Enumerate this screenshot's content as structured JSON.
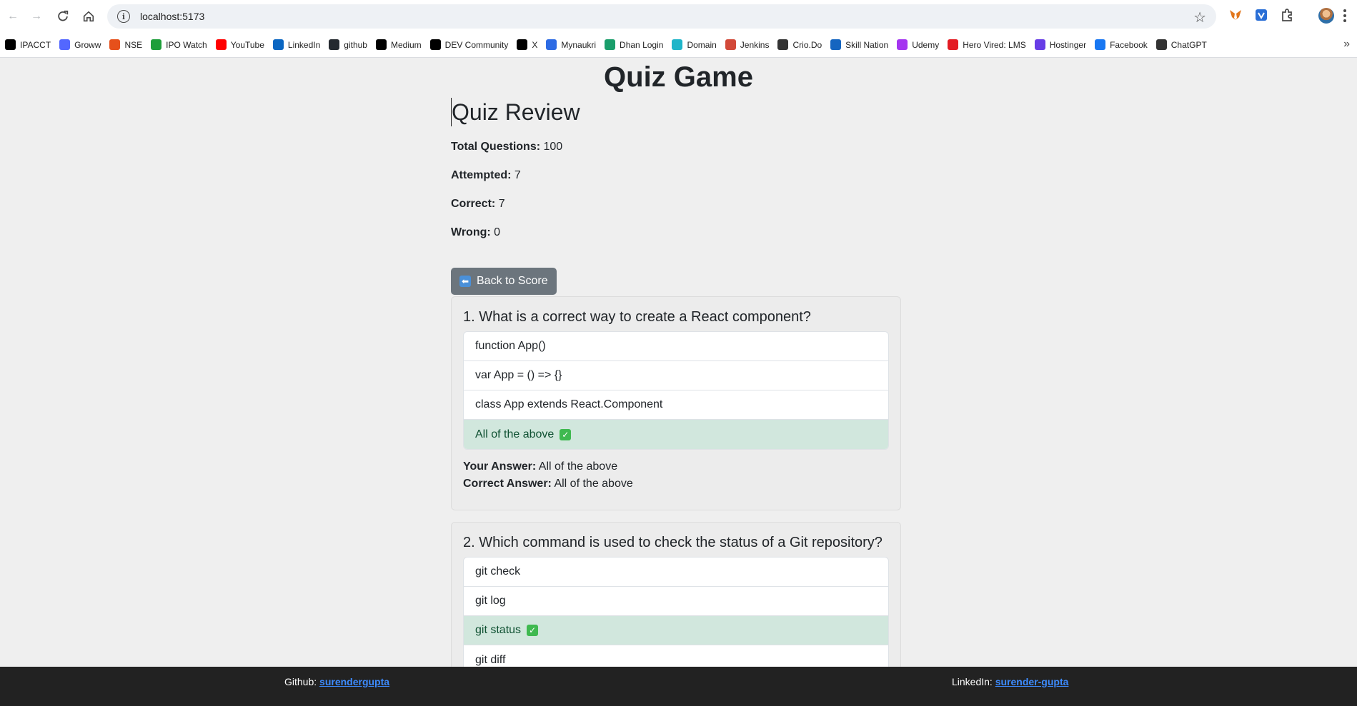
{
  "browser": {
    "url": "localhost:5173",
    "bookmarks": [
      {
        "label": "IPACCT",
        "icon": "ip-icon",
        "color": "#000000"
      },
      {
        "label": "Groww",
        "icon": "groww-icon",
        "color": "#5367ff"
      },
      {
        "label": "NSE",
        "icon": "nse-icon",
        "color": "#e6501b"
      },
      {
        "label": "IPO Watch",
        "icon": "ipo-icon",
        "color": "#1e9e3a"
      },
      {
        "label": "YouTube",
        "icon": "youtube-icon",
        "color": "#ff0000"
      },
      {
        "label": "LinkedIn",
        "icon": "linkedin-icon",
        "color": "#0a66c2"
      },
      {
        "label": "github",
        "icon": "github-icon",
        "color": "#24292f"
      },
      {
        "label": "Medium",
        "icon": "medium-icon",
        "color": "#000000"
      },
      {
        "label": "DEV Community",
        "icon": "dev-icon",
        "color": "#000000"
      },
      {
        "label": "X",
        "icon": "x-icon",
        "color": "#000000"
      },
      {
        "label": "Mynaukri",
        "icon": "mynaukri-icon",
        "color": "#2d6be4"
      },
      {
        "label": "Dhan Login",
        "icon": "dhan-icon",
        "color": "#1a9e6b"
      },
      {
        "label": "Domain",
        "icon": "domain-icon",
        "color": "#1fb5c9"
      },
      {
        "label": "Jenkins",
        "icon": "jenkins-icon",
        "color": "#d24939"
      },
      {
        "label": "Crio.Do",
        "icon": "crio-icon",
        "color": "#333333"
      },
      {
        "label": "Skill Nation",
        "icon": "skill-nation-icon",
        "color": "#1565c0"
      },
      {
        "label": "Udemy",
        "icon": "udemy-icon",
        "color": "#a435f0"
      },
      {
        "label": "Hero Vired: LMS",
        "icon": "hero-vired-icon",
        "color": "#e31b23"
      },
      {
        "label": "Hostinger",
        "icon": "hostinger-icon",
        "color": "#673de6"
      },
      {
        "label": "Facebook",
        "icon": "facebook-icon",
        "color": "#1877f2"
      },
      {
        "label": "ChatGPT",
        "icon": "chatgpt-icon",
        "color": "#333333"
      }
    ]
  },
  "app": {
    "title": "Quiz Game",
    "review_title": "Quiz Review",
    "stats": {
      "total_label": "Total Questions:",
      "total": "100",
      "attempted_label": "Attempted:",
      "attempted": "7",
      "correct_label": "Correct:",
      "correct": "7",
      "wrong_label": "Wrong:",
      "wrong": "0"
    },
    "back_label": "Back to Score",
    "your_answer_label": "Your Answer:",
    "correct_answer_label": "Correct Answer:",
    "questions": [
      {
        "text": "1. What is a correct way to create a React component?",
        "options": [
          "function App()",
          "var App = () => {}",
          "class App extends React.Component",
          "All of the above"
        ],
        "correct_index": 3,
        "your_answer": "All of the above",
        "correct_answer": "All of the above"
      },
      {
        "text": "2. Which command is used to check the status of a Git repository?",
        "options": [
          "git check",
          "git log",
          "git status",
          "git diff"
        ],
        "correct_index": 2
      }
    ]
  },
  "footer": {
    "github_label": "Github:",
    "github_user": "surendergupta",
    "linkedin_label": "LinkedIn:",
    "linkedin_user": "surender-gupta"
  }
}
